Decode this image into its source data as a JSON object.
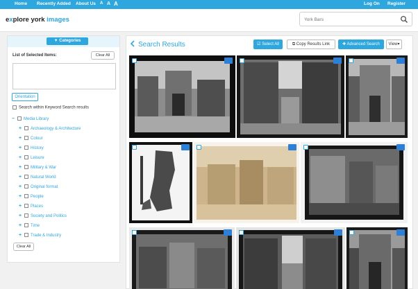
{
  "topnav": {
    "items": [
      "Home",
      "Recently Added",
      "About Us"
    ],
    "text_sizes": [
      "A",
      "A",
      "A"
    ],
    "right": [
      "Log On",
      "Register"
    ]
  },
  "header": {
    "logo": {
      "e": "e",
      "x": "x",
      "plore": "plore york ",
      "images": "images"
    },
    "search": {
      "value": "York Bars",
      "icon": "search-icon"
    }
  },
  "sidebar": {
    "categories_button": "Categories",
    "selected_title": "List of Selected Items:",
    "clear_all_top": "Clear All",
    "orientation_button": "Orientation",
    "within_label": "Search within Keyword Search results",
    "media_library": "Media Library",
    "categories": [
      "Archaeology & Architecture",
      "Colour",
      "History",
      "Leisure",
      "Military & War",
      "Natural World",
      "Original format",
      "People",
      "Places",
      "Society and Politics",
      "Time",
      "Trade & Industry"
    ],
    "clear_all_bottom": "Clear All"
  },
  "results": {
    "title": "Search Results",
    "select_all": "Select All",
    "copy_link": "Copy Results Link",
    "advanced_search": "Advanced Search",
    "view": "View"
  },
  "colors": {
    "accent": "#2ea6de",
    "icon_blue": "#2e7fd6"
  }
}
